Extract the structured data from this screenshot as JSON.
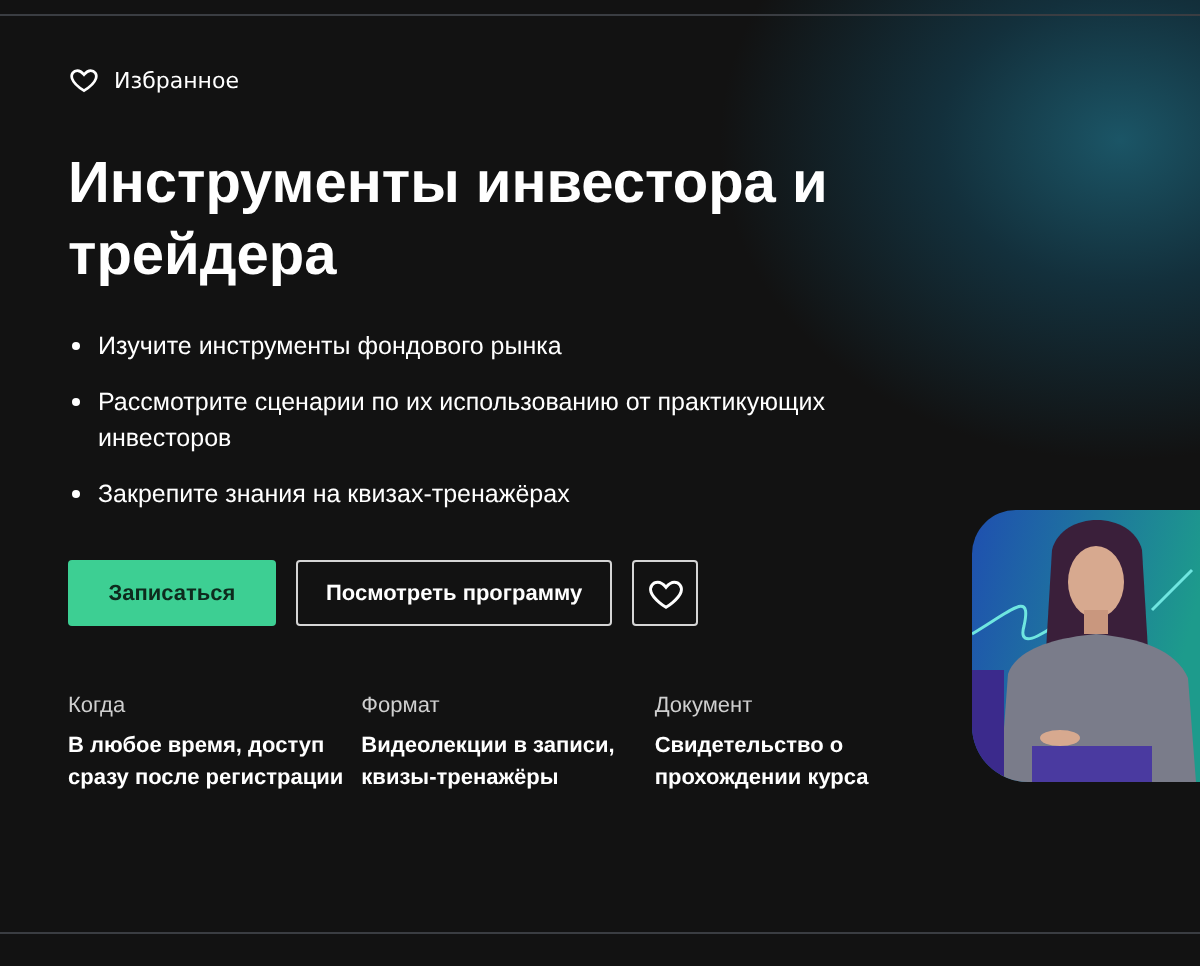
{
  "favorite": {
    "label": "Избранное"
  },
  "title": "Инструменты инвестора и трейдера",
  "bullets": [
    "Изучите инструменты фондового рынка",
    "Рассмотрите сценарии по их использованию от практикующих инвесторов",
    "Закрепите знания на квизах-тренажёрах"
  ],
  "buttons": [
    {
      "kind": "primary",
      "label": "Записаться"
    },
    {
      "kind": "outline",
      "label": "Посмотреть программу"
    },
    {
      "kind": "heart"
    }
  ],
  "facts": [
    {
      "label": "Когда",
      "value": "В любое время, доступ сразу после регистрации"
    },
    {
      "label": "Формат",
      "value": "Видеолекции в записи, квизы-тренажёры"
    },
    {
      "label": "Документ",
      "value": "Свидетельство о прохождении курса"
    }
  ]
}
